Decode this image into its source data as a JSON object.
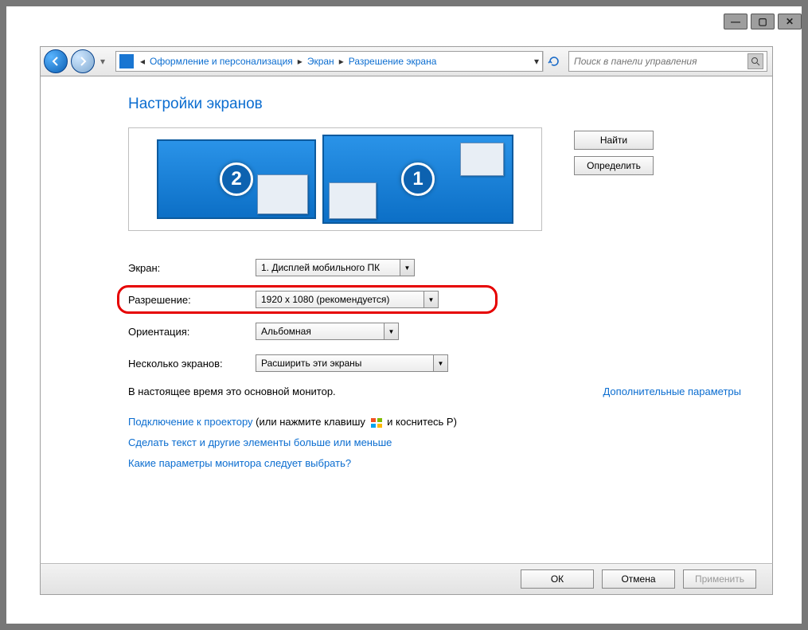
{
  "window": {
    "minimize": "—",
    "maximize": "▢",
    "close": "✕"
  },
  "breadcrumb": {
    "item1": "Оформление и персонализация",
    "item2": "Экран",
    "item3": "Разрешение экрана"
  },
  "search": {
    "placeholder": "Поиск в панели управления"
  },
  "page": {
    "title": "Настройки экранов"
  },
  "side": {
    "find": "Найти",
    "identify": "Определить"
  },
  "monitors": {
    "num1": "1",
    "num2": "2"
  },
  "form": {
    "display_label": "Экран:",
    "display_value": "1. Дисплей мобильного ПК",
    "resolution_label": "Разрешение:",
    "resolution_value": "1920 x 1080 (рекомендуется)",
    "orientation_label": "Ориентация:",
    "orientation_value": "Альбомная",
    "multi_label": "Несколько экранов:",
    "multi_value": "Расширить эти экраны"
  },
  "status": {
    "main": "В настоящее время это основной монитор.",
    "advanced": "Дополнительные параметры"
  },
  "links": {
    "proj_a": "Подключение к проектору",
    "proj_b": " (или нажмите клавишу ",
    "proj_c": " и коснитесь P)",
    "scale": "Сделать текст и другие элементы больше или меньше",
    "help": "Какие параметры монитора следует выбрать?"
  },
  "footer": {
    "ok": "ОК",
    "cancel": "Отмена",
    "apply": "Применить"
  }
}
